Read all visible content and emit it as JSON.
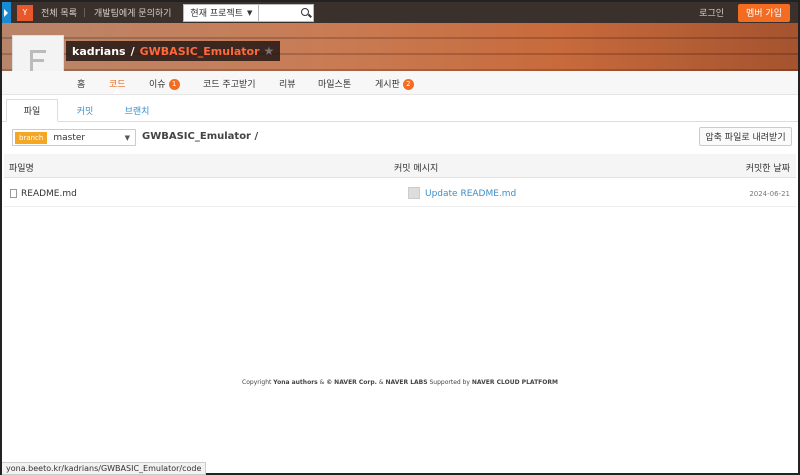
{
  "topbar": {
    "logo": "Y",
    "all_list": "전체 목록",
    "contact": "개발팀에게 문의하기",
    "project_select": "현재 프로젝트",
    "login": "로그인",
    "signup": "멤버 가입"
  },
  "repo": {
    "owner": "kadrians",
    "slash": "/",
    "name": "GWBASIC_Emulator",
    "star": "★"
  },
  "nav": {
    "home": "홈",
    "code": "코드",
    "issues": "이슈",
    "issues_count": "1",
    "pull_requests": "코드 주고받기",
    "review": "리뷰",
    "milestones": "마일스톤",
    "board": "게시판",
    "board_count": "2"
  },
  "subtabs": {
    "files": "파일",
    "commits": "커밋",
    "branches": "브랜치"
  },
  "branch": {
    "label": "branch",
    "value": "master"
  },
  "path": "GWBASIC_Emulator /",
  "download_button": "압축 파일로 내려받기",
  "table": {
    "headers": [
      "파일명",
      "커밋 메시지",
      "커밋한 날짜"
    ],
    "rows": [
      {
        "name": "README.md",
        "message": "Update README.md",
        "date": "2024-06-21"
      }
    ]
  },
  "footer": {
    "copyright": "Copyright",
    "yona": "Yona authors",
    "amp1": "&",
    "c": "©",
    "naver": "NAVER Corp.",
    "amp2": "&",
    "labs": "NAVER LABS",
    "supported": "Supported by",
    "cloud": "NAVER CLOUD PLATFORM"
  },
  "statusbar": "yona.beeto.kr/kadrians/GWBASIC_Emulator/code",
  "colors": {
    "accent": "#f36c21",
    "link": "#3a8fc8",
    "topbar": "#3a302c"
  }
}
